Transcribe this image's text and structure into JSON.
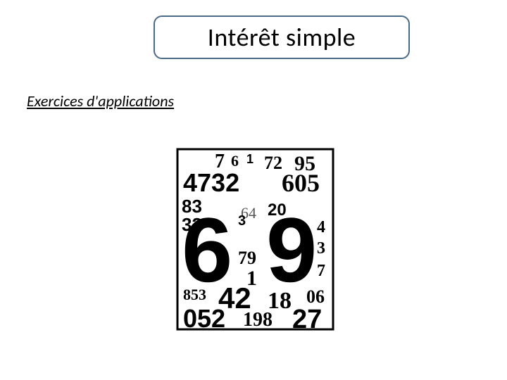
{
  "title": "Intérêt simple",
  "subheading": "Exercices d'applications"
}
